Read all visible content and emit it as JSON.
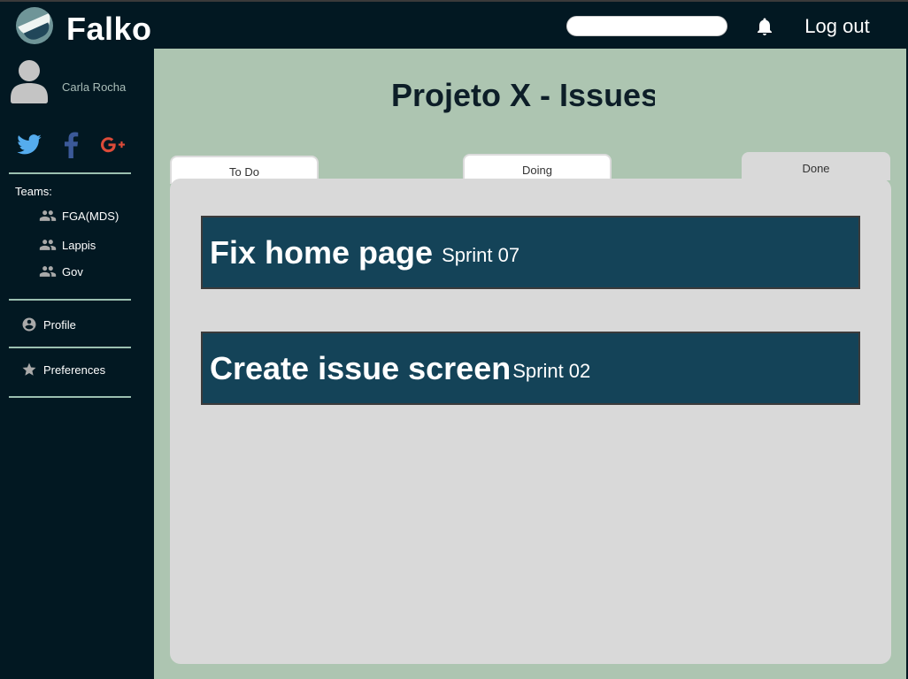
{
  "app": {
    "brand": "Falko"
  },
  "header": {
    "logout_label": "Log out"
  },
  "user": {
    "name": "Carla Rocha"
  },
  "social": [
    "twitter-icon",
    "facebook-icon",
    "google-plus-icon"
  ],
  "sidebar": {
    "teams_label": "Teams:",
    "teams": [
      {
        "label": "FGA(MDS)"
      },
      {
        "label": "Lappis"
      },
      {
        "label": "Gov"
      }
    ],
    "menu": [
      {
        "label": "Profile",
        "icon": "account-circle-icon"
      },
      {
        "label": "Preferences",
        "icon": "star-icon"
      }
    ]
  },
  "main": {
    "title": "Projeto X - Issues",
    "tabs": [
      {
        "label": "To Do"
      },
      {
        "label": "Doing"
      },
      {
        "label": "Done",
        "active": true
      }
    ],
    "issues": [
      {
        "title": "Fix home page",
        "sprint": "Sprint 07"
      },
      {
        "title": "Create issue screen",
        "sprint": "Sprint 02"
      }
    ]
  },
  "colors": {
    "background": "#021822",
    "main_bg": "#adc5b1",
    "board_bg": "#d9d9d9",
    "card_bg": "#144358",
    "twitter": "#55acee",
    "facebook": "#3b5998",
    "google": "#dd4b39"
  }
}
